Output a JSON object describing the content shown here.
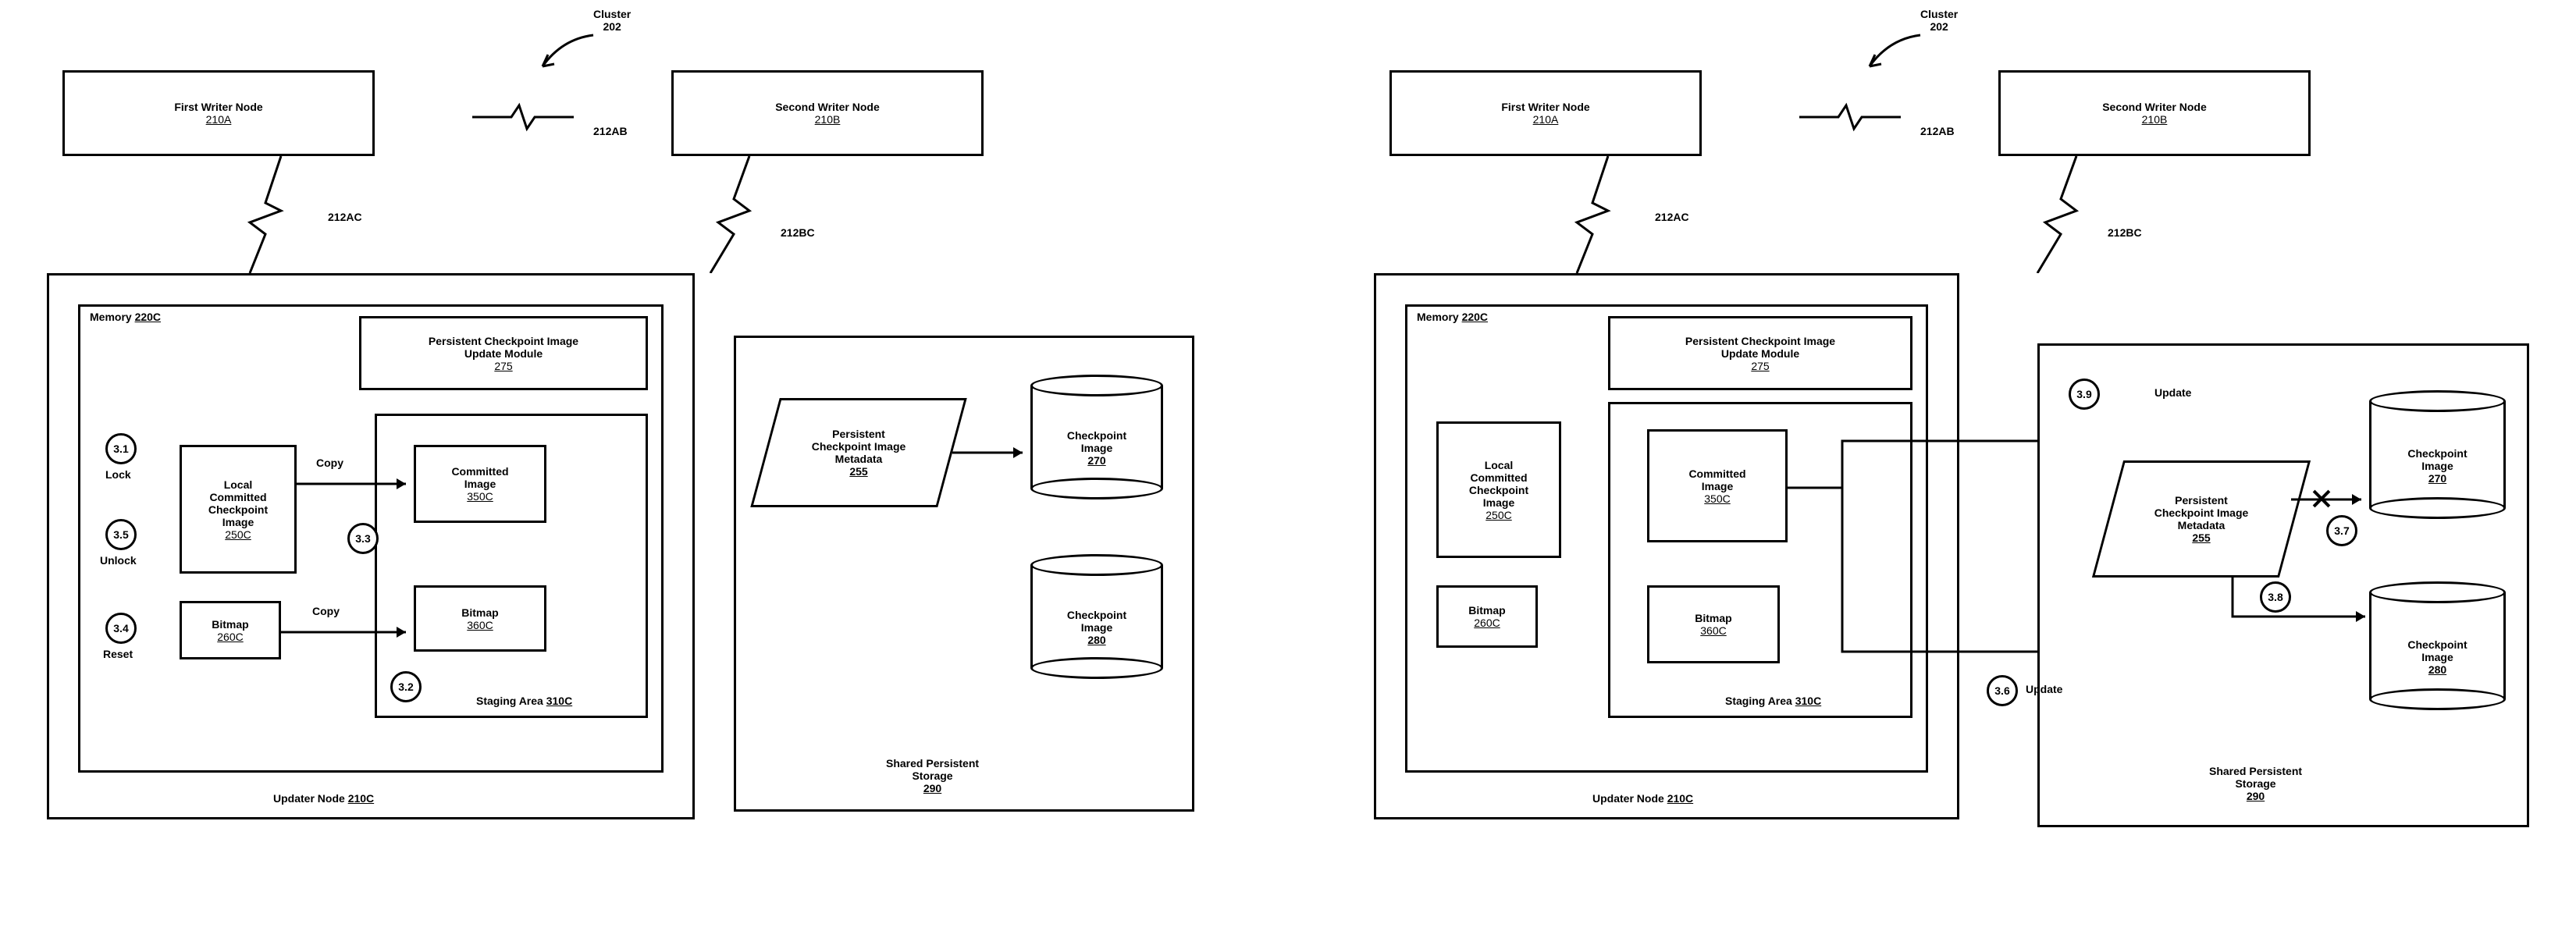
{
  "cluster": {
    "label": "Cluster",
    "ref": "202"
  },
  "nodes": {
    "firstWriter": {
      "title": "First Writer Node",
      "ref": "210A"
    },
    "secondWriter": {
      "title": "Second Writer Node",
      "ref": "210B"
    },
    "updater": {
      "label": "Updater Node",
      "ref": "210C"
    }
  },
  "links": {
    "ab": "212AB",
    "ac": "212AC",
    "bc": "212BC"
  },
  "memory": {
    "label": "Memory",
    "ref": "220C"
  },
  "updateModule": {
    "l1": "Persistent Checkpoint Image",
    "l2": "Update Module",
    "ref": "275"
  },
  "localImg": {
    "l1": "Local",
    "l2": "Committed",
    "l3": "Checkpoint",
    "l4": "Image",
    "ref": "250C"
  },
  "bitmap250": {
    "label": "Bitmap",
    "ref": "260C"
  },
  "committed": {
    "l1": "Committed",
    "l2": "Image",
    "ref": "350C"
  },
  "bitmap360": {
    "label": "Bitmap",
    "ref": "360C"
  },
  "staging": {
    "label": "Staging Area",
    "ref": "310C"
  },
  "metadata": {
    "l1": "Persistent",
    "l2": "Checkpoint Image",
    "l3": "Metadata",
    "ref": "255"
  },
  "ckpt270": {
    "l1": "Checkpoint",
    "l2": "Image",
    "ref": "270"
  },
  "ckpt280": {
    "l1": "Checkpoint",
    "l2": "Image",
    "ref": "280"
  },
  "storage": {
    "l1": "Shared Persistent",
    "l2": "Storage",
    "ref": "290"
  },
  "copy": "Copy",
  "update": "Update",
  "stepsLeft": {
    "s31": {
      "num": "3.1",
      "label": "Lock"
    },
    "s35": {
      "num": "3.5",
      "label": "Unlock"
    },
    "s34": {
      "num": "3.4",
      "label": "Reset"
    },
    "s33": {
      "num": "3.3"
    },
    "s32": {
      "num": "3.2"
    }
  },
  "stepsRight": {
    "s36": {
      "num": "3.6"
    },
    "s37": {
      "num": "3.7"
    },
    "s38": {
      "num": "3.8"
    },
    "s39": {
      "num": "3.9"
    }
  }
}
